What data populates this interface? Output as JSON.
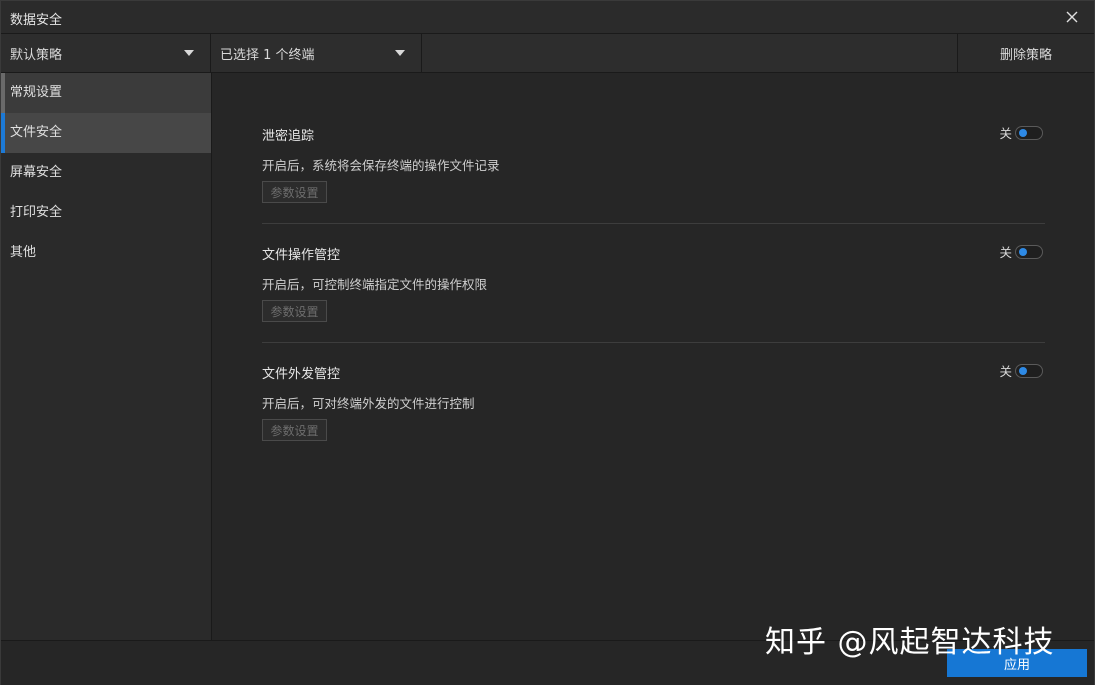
{
  "window": {
    "title": "数据安全"
  },
  "toolbar": {
    "policy_select": "默认策略",
    "terminal_select": "已选择 1 个终端",
    "delete_label": "删除策略"
  },
  "sidebar": {
    "items": [
      {
        "label": "常规设置"
      },
      {
        "label": "文件安全"
      },
      {
        "label": "屏幕安全"
      },
      {
        "label": "打印安全"
      },
      {
        "label": "其他"
      }
    ],
    "active_index": 1
  },
  "sections": [
    {
      "title": "泄密追踪",
      "description": "开启后，系统将会保存终端的操作文件记录",
      "toggle_label": "关",
      "param_label": "参数设置"
    },
    {
      "title": "文件操作管控",
      "description": "开启后，可控制终端指定文件的操作权限",
      "toggle_label": "关",
      "param_label": "参数设置"
    },
    {
      "title": "文件外发管控",
      "description": "开启后，可对终端外发的文件进行控制",
      "toggle_label": "关",
      "param_label": "参数设置"
    }
  ],
  "footer": {
    "apply_label": "应用"
  },
  "watermark": {
    "text": "知乎 @风起智达科技"
  },
  "colors": {
    "accent": "#1677d4",
    "toggle_knob": "#2e8ae6",
    "background": "#262626"
  }
}
